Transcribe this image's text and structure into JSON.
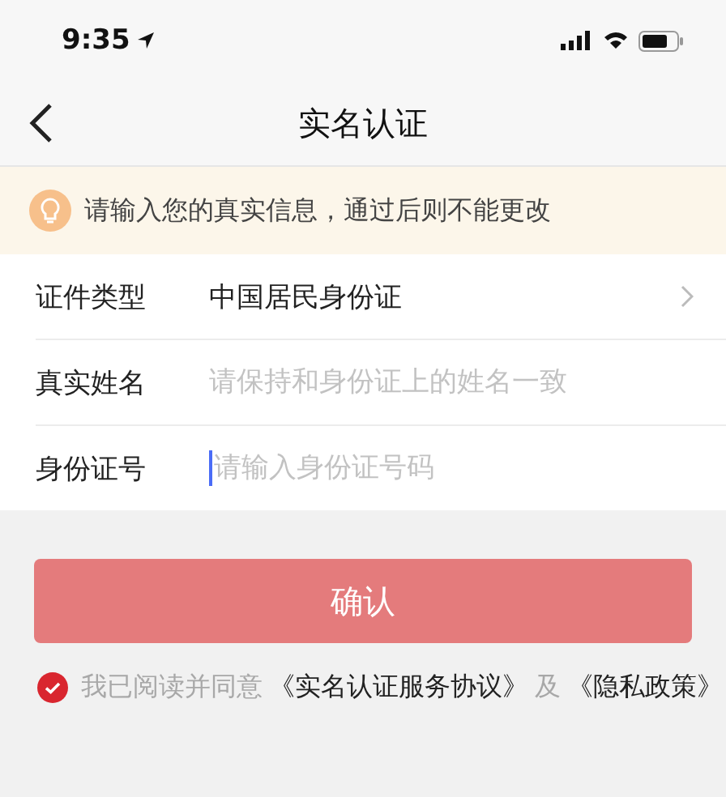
{
  "status_bar": {
    "time": "9:35"
  },
  "nav": {
    "title": "实名认证"
  },
  "notice": {
    "text": "请输入您的真实信息，通过后则不能更改"
  },
  "form": [
    {
      "kind": "select",
      "label": "证件类型",
      "value": "中国居民身份证"
    },
    {
      "kind": "input",
      "label": "真实姓名",
      "placeholder": "请保持和身份证上的姓名一致",
      "focused": false
    },
    {
      "kind": "input",
      "label": "身份证号",
      "placeholder": "请输入身份证号码",
      "focused": true
    }
  ],
  "confirm_button": {
    "label": "确认"
  },
  "agreement": {
    "checked": true,
    "parts": [
      {
        "kind": "text",
        "text": "我已阅读并同意"
      },
      {
        "kind": "link",
        "text": "《实名认证服务协议》"
      },
      {
        "kind": "text",
        "text": "及"
      },
      {
        "kind": "link",
        "text": "《隐私政策》"
      }
    ]
  }
}
